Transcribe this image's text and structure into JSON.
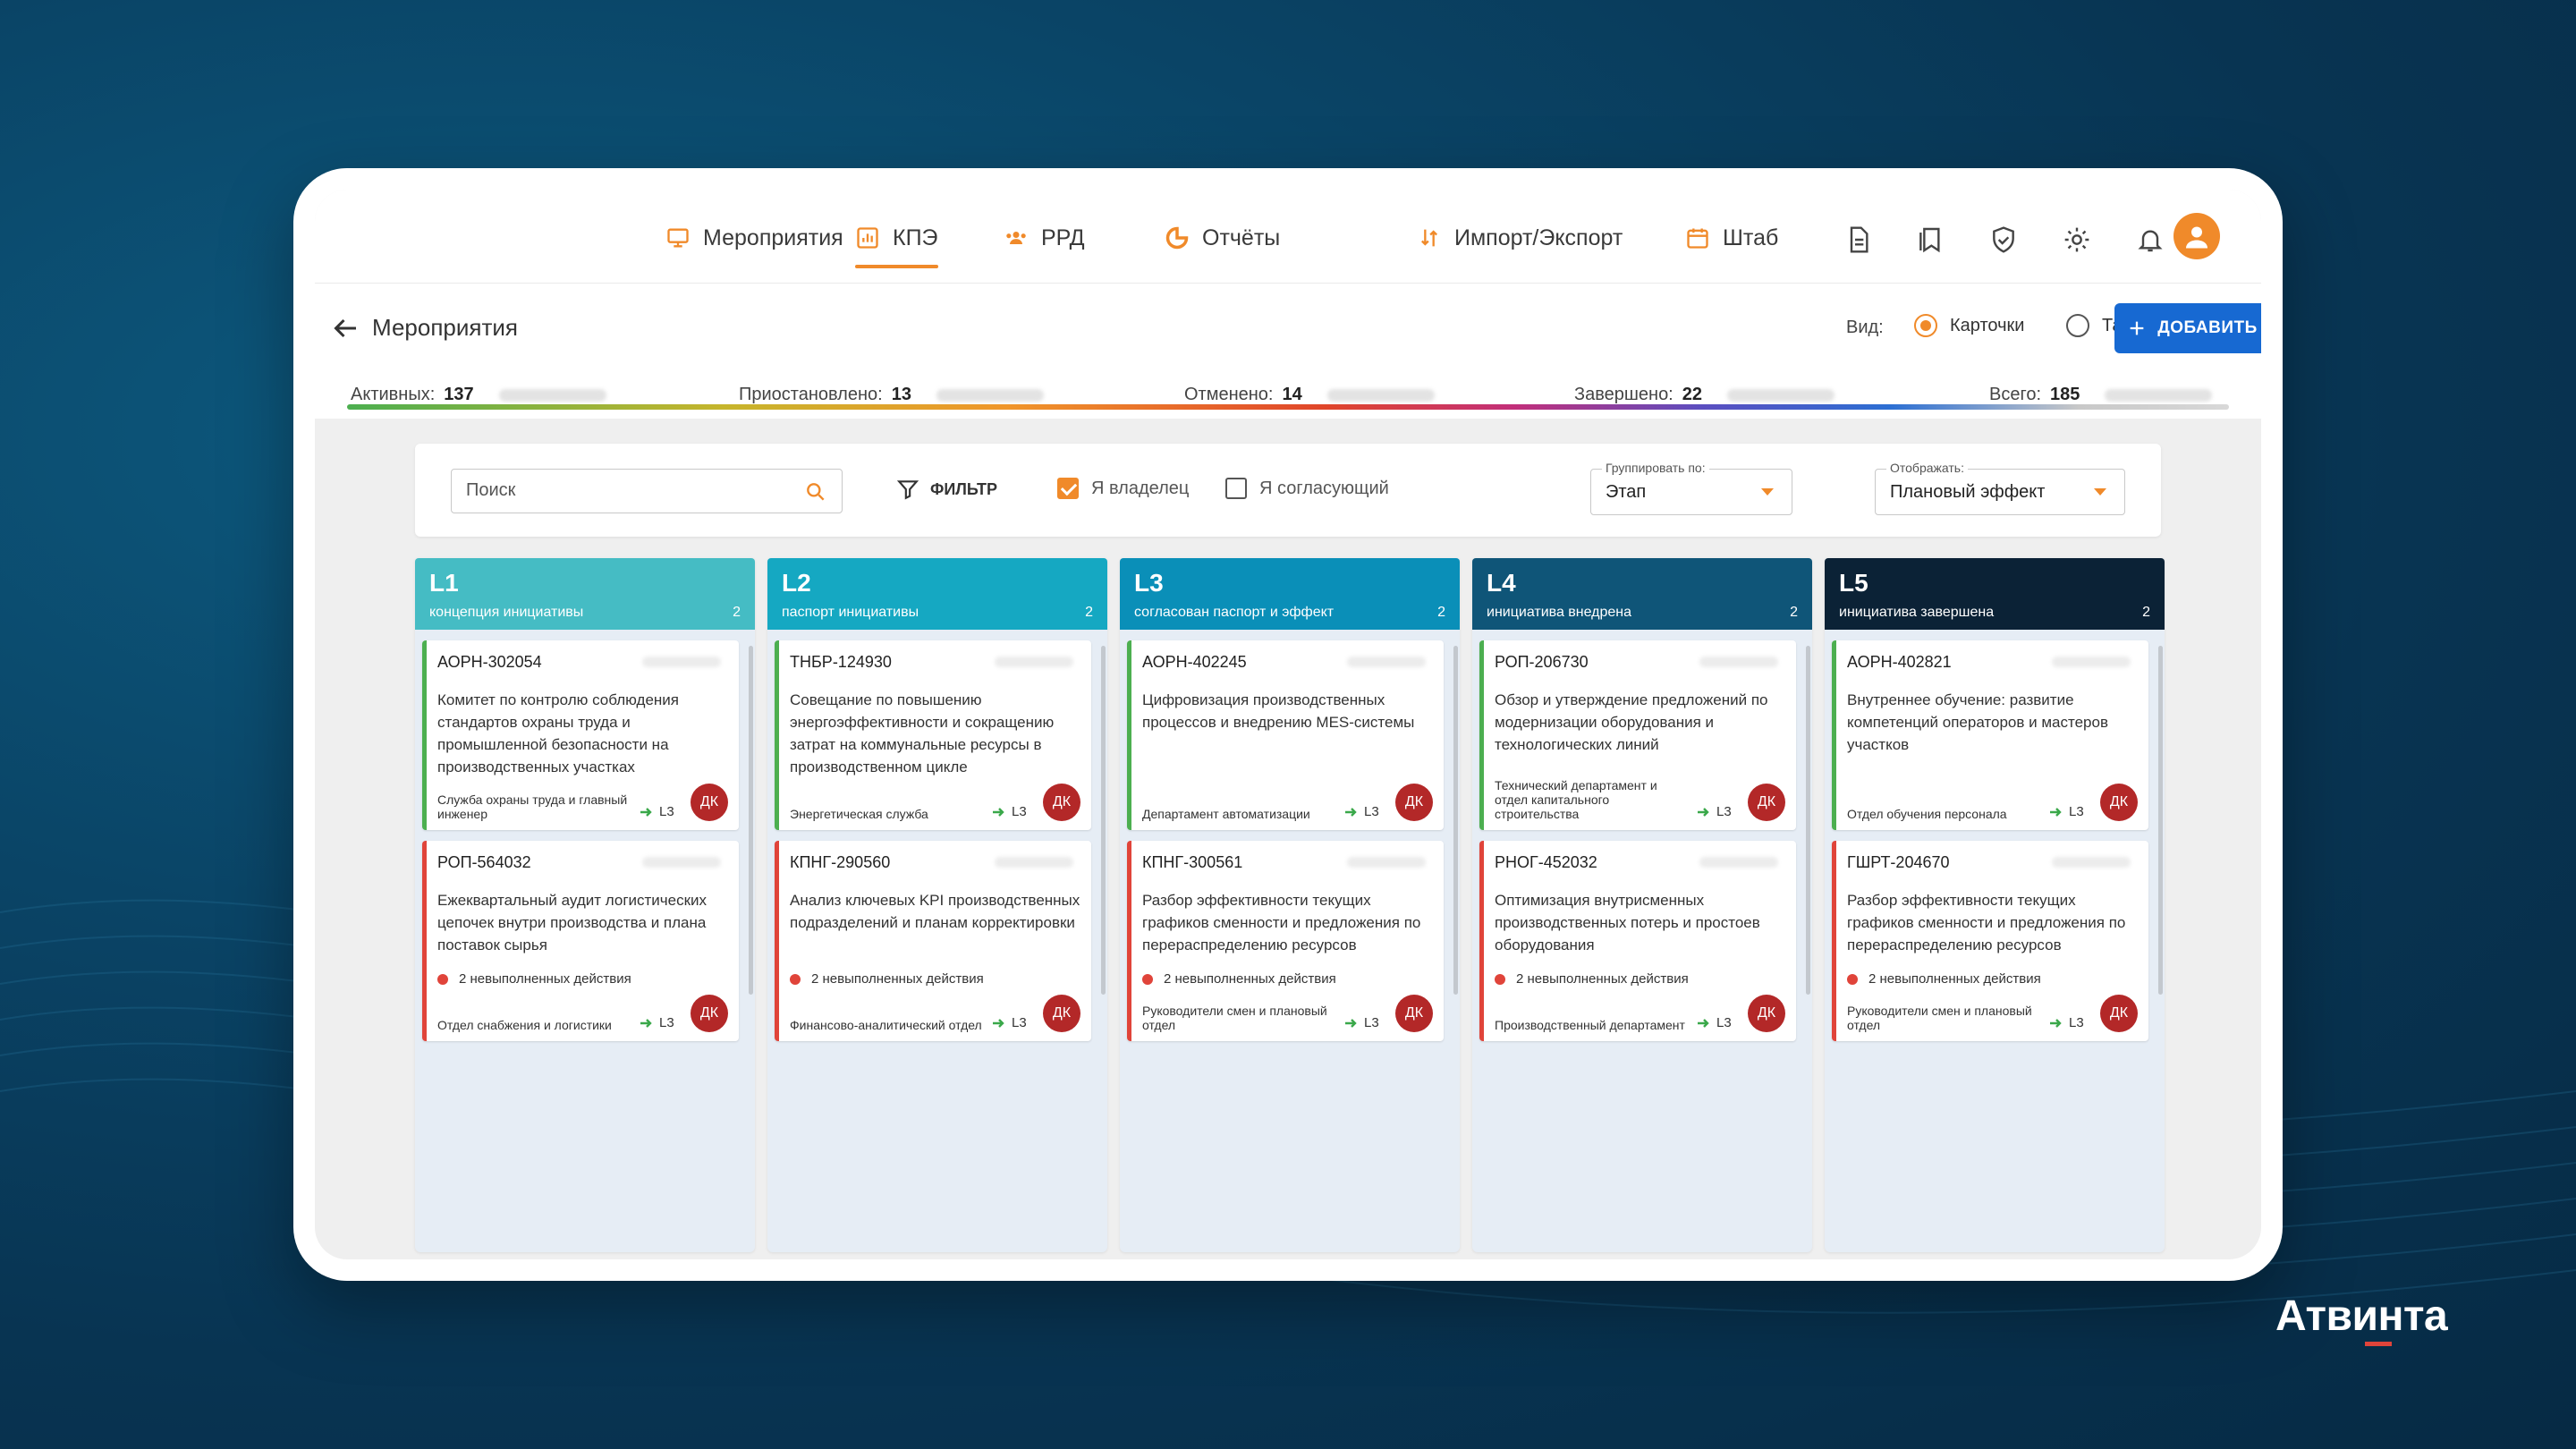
{
  "nav": {
    "items": [
      {
        "label": "Мероприятия",
        "icon": "monitor-icon"
      },
      {
        "label": "КПЭ",
        "icon": "bar-chart-icon",
        "active": true
      },
      {
        "label": "РРД",
        "icon": "team-icon"
      },
      {
        "label": "Отчёты",
        "icon": "pie-chart-icon"
      },
      {
        "label": "Импорт/Экспорт",
        "icon": "import-export-icon"
      },
      {
        "label": "Штаб",
        "icon": "calendar-icon"
      }
    ],
    "icons": [
      "document-icon",
      "bookmarks-icon",
      "shield-icon",
      "gear-icon",
      "bell-icon",
      "user-avatar-icon"
    ],
    "accent": "#f08a2a"
  },
  "header": {
    "title": "Мероприятия",
    "view_label": "Вид:",
    "view_cards": "Карточки",
    "view_table": "Таблица",
    "add_label": "ДОБАВИТЬ",
    "add_color": "#1769d2"
  },
  "stats": {
    "active_label": "Активных:",
    "active_value": "137",
    "paused_label": "Приостановлено:",
    "paused_value": "13",
    "canceled_label": "Отменено:",
    "canceled_value": "14",
    "done_label": "Завершено:",
    "done_value": "22",
    "total_label": "Всего:",
    "total_value": "185"
  },
  "filters": {
    "search_placeholder": "Поиск",
    "filter_label": "ФИЛЬТР",
    "owner_label": "Я владелец",
    "owner_checked": true,
    "approver_label": "Я согласующий",
    "approver_checked": false,
    "group_label": "Группировать по:",
    "group_value": "Этап",
    "show_label": "Отображать:",
    "show_value": "Плановый эффект"
  },
  "columns": [
    {
      "code": "L1",
      "subtitle": "концепция инициативы",
      "count": "2",
      "color": "#45bcc4",
      "cards": [
        {
          "id": "АОРН-302054",
          "title": "Комитет по контролю соблюдения стандартов охраны труда и промышленной безопасности на производственных участках",
          "dept": "Служба охраны труда и главный инженер",
          "level": "L3",
          "avatar": "ДК",
          "status": "green"
        },
        {
          "id": "РОП-564032",
          "title": "Ежеквартальный аудит логистических цепочек внутри производства и плана поставок сырья",
          "warning": "2 невыполненных действия",
          "dept": "Отдел снабжения и логистики",
          "level": "L3",
          "avatar": "ДК",
          "status": "red"
        }
      ]
    },
    {
      "code": "L2",
      "subtitle": "паспорт инициативы",
      "count": "2",
      "color": "#15a8c2",
      "cards": [
        {
          "id": "ТНБР-124930",
          "title": "Совещание по повышению энергоэффективности и сокращению затрат на коммунальные ресурсы в производственном цикле",
          "dept": "Энергетическая служба",
          "level": "L3",
          "avatar": "ДК",
          "status": "green"
        },
        {
          "id": "КПНГ-290560",
          "title": "Анализ ключевых KPI производственных подразделений и планам корректировки",
          "warning": "2 невыполненных действия",
          "dept": "Финансово-аналитический отдел",
          "level": "L3",
          "avatar": "ДК",
          "status": "red"
        }
      ]
    },
    {
      "code": "L3",
      "subtitle": "согласован паспорт и эффект",
      "count": "2",
      "color": "#0a8fb8",
      "cards": [
        {
          "id": "АОРН-402245",
          "title": "Цифровизация производственных процессов и внедрению MES-системы",
          "dept": "Департамент автоматизации",
          "level": "L3",
          "avatar": "ДК",
          "status": "green"
        },
        {
          "id": "КПНГ-300561",
          "title": "Разбор эффективности текущих графиков сменности и предложения по перераспределению ресурсов",
          "warning": "2 невыполненных действия",
          "dept": "Руководители смен и плановый отдел",
          "level": "L3",
          "avatar": "ДК",
          "status": "red"
        }
      ]
    },
    {
      "code": "L4",
      "subtitle": "инициатива внедрена",
      "count": "2",
      "color": "#0f5578",
      "cards": [
        {
          "id": "РОП-206730",
          "title": "Обзор и утверждение предложений по модернизации оборудования и технологических линий",
          "dept": "Технический департамент и отдел капитального строительства",
          "level": "L3",
          "avatar": "ДК",
          "status": "green"
        },
        {
          "id": "РНОГ-452032",
          "title": "Оптимизация внутрисменных производственных потерь и простоев оборудования",
          "warning": "2 невыполненных действия",
          "dept": "Производственный департамент",
          "level": "L3",
          "avatar": "ДК",
          "status": "red"
        }
      ]
    },
    {
      "code": "L5",
      "subtitle": "инициатива завершена",
      "count": "2",
      "color": "#0b2236",
      "cards": [
        {
          "id": "АОРН-402821",
          "title": "Внутреннее обучение: развитие компетенций операторов и мастеров участков",
          "dept": "Отдел обучения персонала",
          "level": "L3",
          "avatar": "ДК",
          "status": "green"
        },
        {
          "id": "ГШРТ-204670",
          "title": "Разбор эффективности текущих графиков сменности и предложения по перераспределению ресурсов",
          "warning": "2 невыполненных действия",
          "dept": "Руководители смен и плановый отдел",
          "level": "L3",
          "avatar": "ДК",
          "status": "red"
        }
      ]
    }
  ],
  "brand": "Атвинта"
}
